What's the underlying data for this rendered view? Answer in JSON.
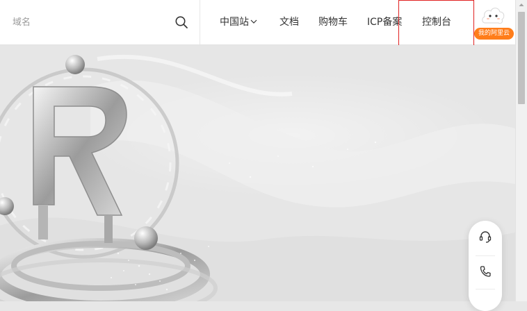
{
  "search": {
    "placeholder": "域名"
  },
  "nav": {
    "items": [
      {
        "label": "中国站"
      },
      {
        "label": "文档"
      },
      {
        "label": "购物车"
      },
      {
        "label": "ICP备案"
      },
      {
        "label": "控制台"
      }
    ]
  },
  "user": {
    "badge_label": "我的阿里云"
  },
  "colors": {
    "accent": "#ff7d1a",
    "highlight_box": "#e02020",
    "hero_bg": "#e7e7e7"
  },
  "icons": {
    "search": "search-icon",
    "dropdown": "chevron-down-icon",
    "avatar": "cloud-mascot-icon",
    "support": "headset-icon",
    "phone": "phone-icon"
  }
}
